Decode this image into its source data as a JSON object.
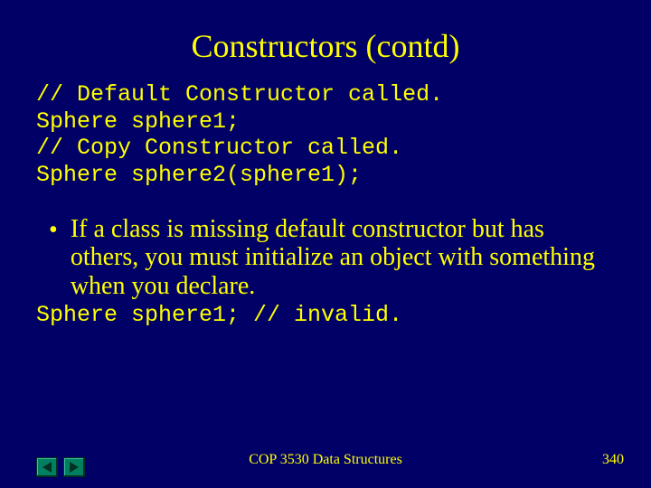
{
  "title": "Constructors (contd)",
  "code_block": "// Default Constructor called.\nSphere sphere1;\n// Copy Constructor called.\nSphere sphere2(sphere1);",
  "bullet": {
    "marker": "•",
    "text": "If a class is missing default constructor but has others, you must initialize an object with something when you declare."
  },
  "code_invalid": "Sphere sphere1; // invalid.",
  "footer": {
    "center": "COP 3530 Data Structures",
    "page": "340"
  },
  "nav": {
    "prev": "prev-slide",
    "next": "next-slide"
  }
}
